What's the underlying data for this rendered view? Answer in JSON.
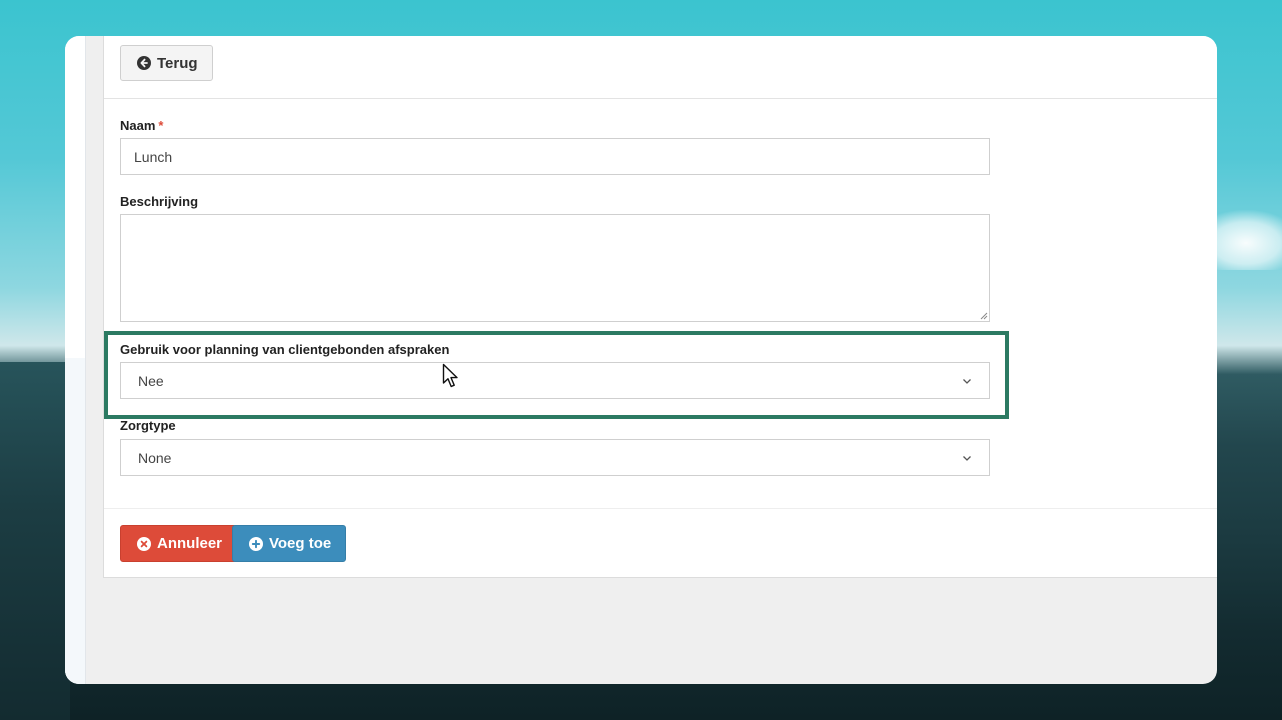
{
  "header": {
    "back_label": "Terug"
  },
  "form": {
    "name": {
      "label": "Naam",
      "required_marker": "*",
      "value": "Lunch"
    },
    "description": {
      "label": "Beschrijving",
      "value": ""
    },
    "planning": {
      "label": "Gebruik voor planning van clientgebonden afspraken",
      "selected": "Nee"
    },
    "care_type": {
      "label": "Zorgtype",
      "selected": "None"
    }
  },
  "footer": {
    "cancel_label": "Annuleer",
    "add_label": "Voeg toe"
  },
  "colors": {
    "danger": "#dd4b39",
    "primary": "#3c8dbc",
    "highlight": "#2c7a62"
  },
  "icons": {
    "back": "arrow-left-circle-icon",
    "cancel": "times-circle-icon",
    "add": "plus-circle-icon",
    "dropdown": "chevron-down-icon"
  }
}
